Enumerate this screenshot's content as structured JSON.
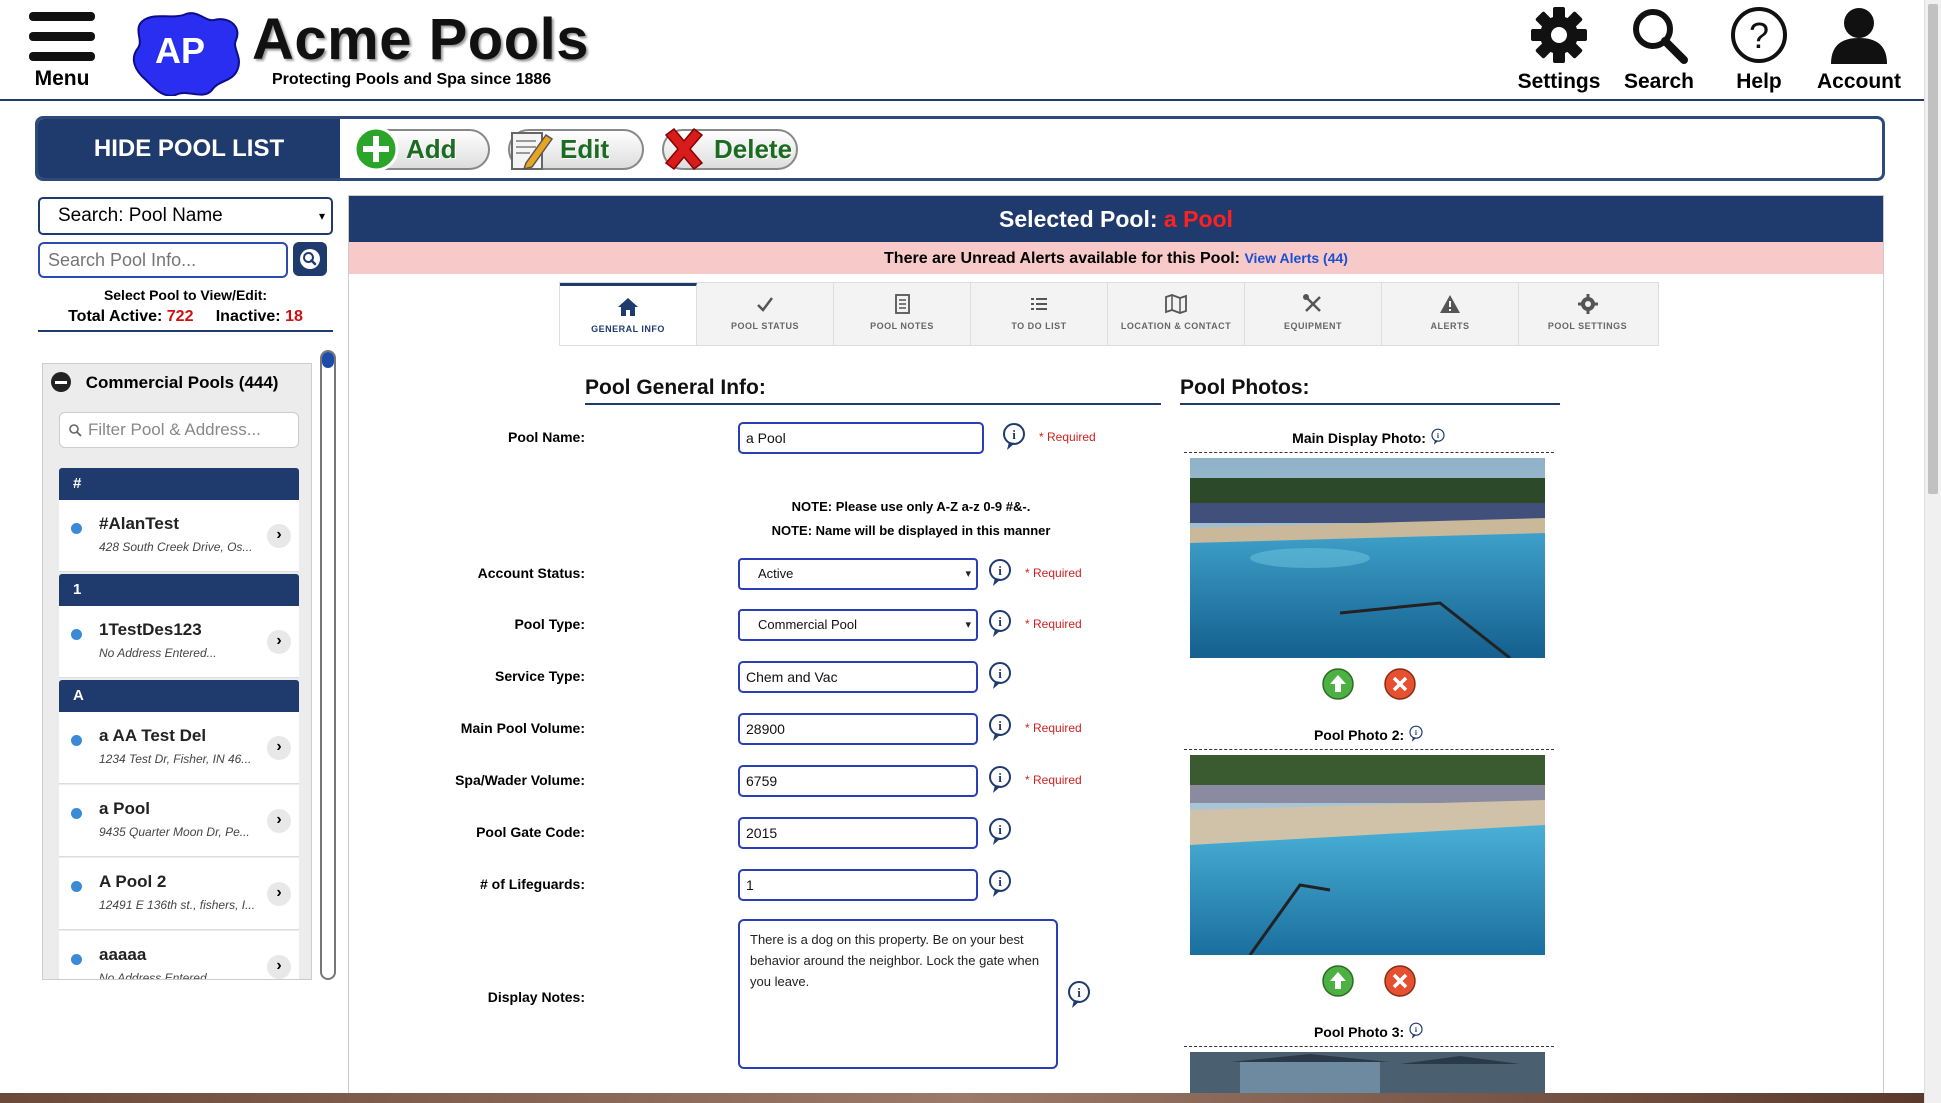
{
  "header": {
    "menu_label": "Menu",
    "logo_initials": "AP",
    "brand_title": "Acme Pools",
    "brand_subtitle": "Protecting Pools and Spa since 1886",
    "settings_label": "Settings",
    "search_label": "Search",
    "help_label": "Help",
    "account_label": "Account"
  },
  "actionbar": {
    "hide_label": "HIDE POOL LIST",
    "add_label": "Add",
    "edit_label": "Edit",
    "delete_label": "Delete"
  },
  "sidebar": {
    "search_mode": "Search: Pool Name",
    "search_placeholder": "Search Pool Info...",
    "select_caption": "Select Pool to View/Edit:",
    "total_active_label": "Total Active:",
    "total_active": "722",
    "inactive_label": "Inactive:",
    "inactive": "18",
    "group_label": "Commercial Pools (444)",
    "filter_placeholder": "Filter Pool & Address...",
    "letters": [
      "#",
      "1",
      "A"
    ],
    "pools": [
      {
        "name": "#AlanTest",
        "address": "428 South Creek Drive, Os..."
      },
      {
        "name": "1TestDes123",
        "address": "No Address Entered..."
      },
      {
        "name": "a AA Test Del",
        "address": "1234 Test Dr, Fisher, IN 46..."
      },
      {
        "name": "a Pool",
        "address": "9435 Quarter Moon Dr, Pe..."
      },
      {
        "name": "A Pool 2",
        "address": "12491 E 136th st., fishers, I..."
      },
      {
        "name": "aaaaa",
        "address": "No Address Entered..."
      }
    ]
  },
  "main": {
    "selected_prefix": "Selected Pool:",
    "selected_name": "a Pool",
    "alert_text": "There are Unread Alerts available for this Pool:",
    "alert_link": "View Alerts (44)",
    "tabs": [
      {
        "label": "GENERAL INFO",
        "icon": "home-icon"
      },
      {
        "label": "POOL STATUS",
        "icon": "check-icon"
      },
      {
        "label": "POOL NOTES",
        "icon": "document-icon"
      },
      {
        "label": "TO DO LIST",
        "icon": "list-icon"
      },
      {
        "label": "LOCATION & CONTACT",
        "icon": "map-icon"
      },
      {
        "label": "EQUIPMENT",
        "icon": "tools-icon"
      },
      {
        "label": "ALERTS",
        "icon": "warning-icon"
      },
      {
        "label": "POOL SETTINGS",
        "icon": "gear-icon"
      }
    ],
    "general_title": "Pool General Info:",
    "photos_title": "Pool Photos:",
    "required_text": "* Required",
    "note_line1": "NOTE: Please use only A-Z a-z 0-9 #&-.",
    "note_line2": "NOTE: Name will be displayed in this manner",
    "fields": {
      "pool_name_label": "Pool Name:",
      "pool_name": "a Pool",
      "account_status_label": "Account Status:",
      "account_status": "Active",
      "pool_type_label": "Pool Type:",
      "pool_type": "Commercial Pool",
      "service_type_label": "Service Type:",
      "service_type": "Chem and Vac",
      "main_volume_label": "Main Pool Volume:",
      "main_volume": "28900",
      "spa_volume_label": "Spa/Wader Volume:",
      "spa_volume": "6759",
      "gate_code_label": "Pool Gate Code:",
      "gate_code": "2015",
      "lifeguards_label": "# of Lifeguards:",
      "lifeguards": "1",
      "display_notes_label": "Display Notes:",
      "display_notes": "There is a dog on this property.  Be on your best behavior around the neighbor.  Lock the gate when you leave."
    },
    "photos": {
      "main_label": "Main Display Photo:",
      "photo2_label": "Pool Photo 2:",
      "photo3_label": "Pool Photo 3:"
    }
  },
  "colors": {
    "navy": "#1f3b6e",
    "alert_bg": "#f8c9c9",
    "required_red": "#d02020",
    "logo_blue": "#2a2ef0"
  }
}
